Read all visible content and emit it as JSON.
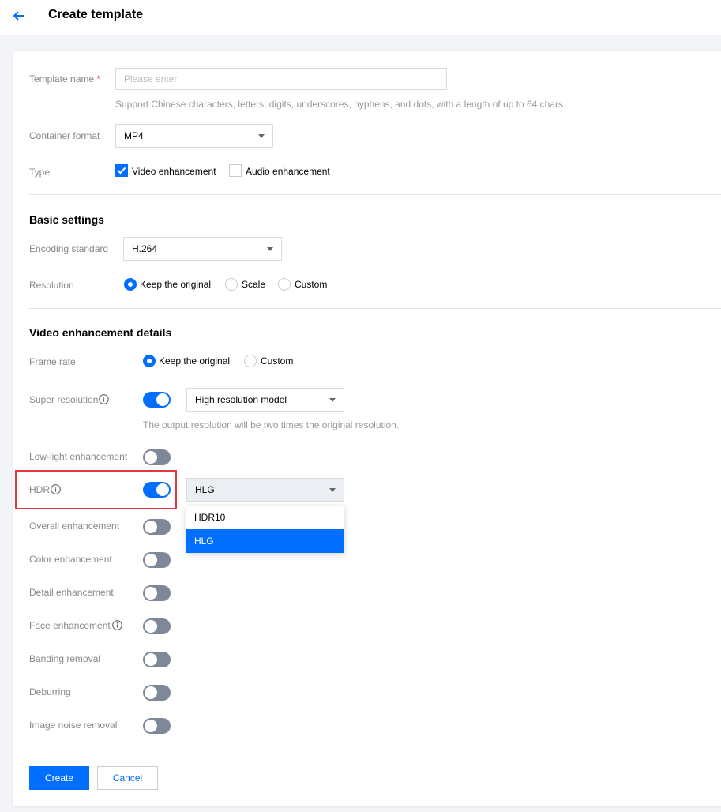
{
  "header": {
    "title": "Create template"
  },
  "form": {
    "template_name": {
      "label": "Template name",
      "required_mark": "*",
      "value": "",
      "placeholder": "Please enter",
      "hint": "Support Chinese characters, letters, digits, underscores, hyphens, and dots, with a length of up to 64 chars."
    },
    "container_format": {
      "label": "Container format",
      "value": "MP4"
    },
    "type": {
      "label": "Type",
      "options": [
        {
          "label": "Video enhancement",
          "checked": true
        },
        {
          "label": "Audio enhancement",
          "checked": false
        }
      ]
    }
  },
  "basic_settings": {
    "title": "Basic settings",
    "encoding_standard": {
      "label": "Encoding standard",
      "value": "H.264"
    },
    "resolution": {
      "label": "Resolution",
      "options": [
        {
          "label": "Keep the original",
          "checked": true
        },
        {
          "label": "Scale",
          "checked": false
        },
        {
          "label": "Custom",
          "checked": false
        }
      ]
    }
  },
  "video_enhancement": {
    "title": "Video enhancement details",
    "frame_rate": {
      "label": "Frame rate",
      "options": [
        {
          "label": "Keep the original",
          "checked": true
        },
        {
          "label": "Custom",
          "checked": false
        }
      ]
    },
    "super_resolution": {
      "label": "Super resolution",
      "on": true,
      "model": "High resolution model",
      "hint": "The output resolution will be two times the original resolution."
    },
    "low_light": {
      "label": "Low-light enhancement",
      "on": false
    },
    "hdr": {
      "label": "HDR",
      "on": true,
      "value": "HLG",
      "options": [
        "HDR10",
        "HLG"
      ],
      "selected_option": "HLG"
    },
    "overall": {
      "label": "Overall enhancement",
      "on": false
    },
    "color": {
      "label": "Color enhancement",
      "on": false
    },
    "detail": {
      "label": "Detail enhancement",
      "on": false
    },
    "face": {
      "label": "Face enhancement",
      "on": false
    },
    "banding": {
      "label": "Banding removal",
      "on": false
    },
    "deburring": {
      "label": "Deburring",
      "on": false
    },
    "noise": {
      "label": "Image noise removal",
      "on": false
    }
  },
  "actions": {
    "create": "Create",
    "cancel": "Cancel"
  },
  "colors": {
    "primary": "#006eff",
    "toggle_off": "#7e8899",
    "highlight": "#e0383e"
  },
  "icons": {
    "back": "arrow-left-icon",
    "info": "info-icon",
    "check": "check-icon",
    "caret": "caret-down-icon"
  }
}
